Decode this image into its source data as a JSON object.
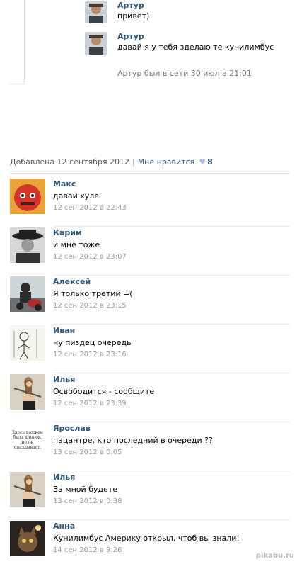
{
  "dialog": {
    "messages": [
      {
        "author": "Артур",
        "text": "привет)"
      },
      {
        "author": "Артур",
        "text": "давай я у тебя зделаю те кунилимбус"
      }
    ],
    "status": "Артур был в сети 30 июл в 21:01"
  },
  "post": {
    "added_label": "Добавлена 12 сентября 2012",
    "separator": "|",
    "like_label": "Мне нравится",
    "like_icon": "heart-icon",
    "like_count": "8"
  },
  "comments": [
    {
      "name": "Макс",
      "text": "давай хуле",
      "date": "12 сен 2012 в 22:43"
    },
    {
      "name": "Карим",
      "text": "и мне тоже",
      "date": "12 сен 2012 в 23:07"
    },
    {
      "name": "Алексей",
      "text": "Я только третий =(",
      "date": "12 сен 2012 в 23:15"
    },
    {
      "name": "Иван",
      "text": "ну пиздец очередь",
      "date": "12 сен 2012 в 23:16"
    },
    {
      "name": "Илья",
      "text": "Освободится - сообщите",
      "date": "12 сен 2012 в 23:39"
    },
    {
      "name": "Ярослав",
      "text": "пацантре, кто последний в очереди ??",
      "date": "13 сен 2012 в 0:05",
      "avatar_text": "Здесь должен быть хлопок, но он опаздывает."
    },
    {
      "name": "Илья",
      "text": "За мной будете",
      "date": "13 сен 2012 в 0:38"
    },
    {
      "name": "Анна",
      "text": "Кунилимбус Америку открыл, чтоб вы знали!",
      "date": "14 сен 2012 в 9:26"
    }
  ],
  "watermark": "pikabu.ru",
  "colors": {
    "link": "#2b587a",
    "muted": "#999999",
    "divider": "#dfe3e8"
  }
}
